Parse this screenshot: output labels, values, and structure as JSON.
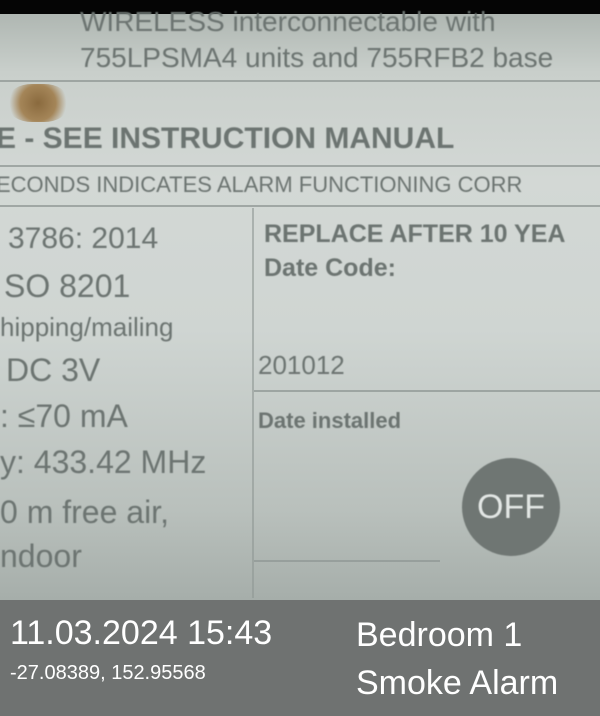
{
  "label": {
    "line_wireless": "WIRELESS interconnectable with",
    "line_units": "755LPSMA4 units and 755RFB2 base",
    "line_manual": "E - SEE INSTRUCTION MANUAL",
    "line_seconds": "ECONDS INDICATES ALARM FUNCTIONING CORR",
    "line_standard": "3786: 2014",
    "line_iso": "SO 8201",
    "line_shipping": "hipping/mailing",
    "line_dc": "DC 3V",
    "line_current": ": ≤70 mA",
    "line_freq": "y: 433.42 MHz",
    "line_range": "0 m free air,",
    "line_indoor": "ndoor",
    "replace": "REPLACE AFTER 10 YEA",
    "date_code_label": "Date Code:",
    "date_code_value": "201012",
    "date_installed_label": "Date installed",
    "off_button": "OFF"
  },
  "overlay": {
    "datetime": "11.03.2024 15:43",
    "coordinates": "-27.08389, 152.95568",
    "location": "Bedroom 1",
    "device": "Smoke Alarm"
  }
}
